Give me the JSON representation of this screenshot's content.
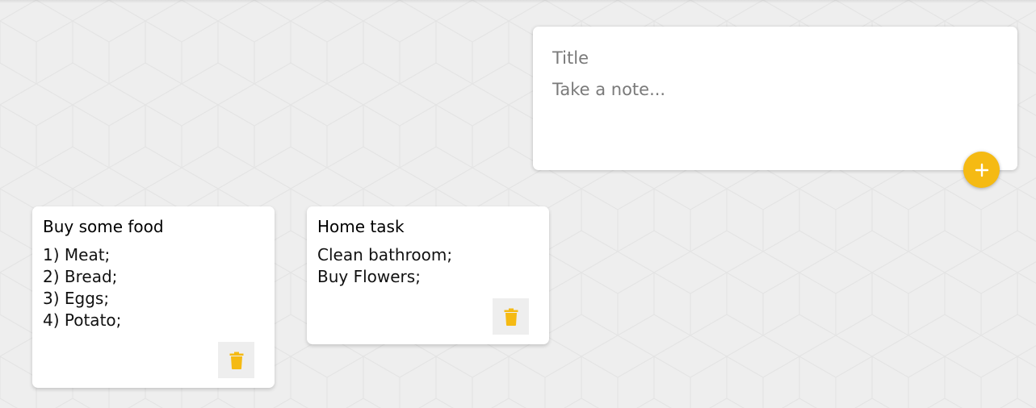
{
  "colors": {
    "accent": "#f5ba13",
    "background": "#eeeeee",
    "card": "#ffffff"
  },
  "composer": {
    "title_placeholder": "Title",
    "content_placeholder": "Take a note...",
    "add_icon": "plus-icon"
  },
  "notes": [
    {
      "title": "Buy some food",
      "lines": [
        "1) Meat;",
        "2) Bread;",
        "3) Eggs;",
        "4) Potato;"
      ],
      "delete_icon": "trash-icon"
    },
    {
      "title": "Home task",
      "lines": [
        "Clean bathroom;",
        "Buy Flowers;"
      ],
      "delete_icon": "trash-icon"
    }
  ]
}
